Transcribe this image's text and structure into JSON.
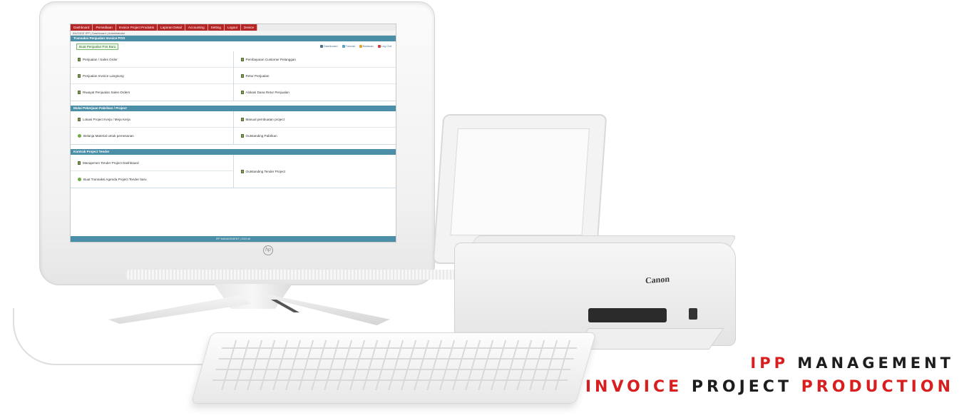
{
  "screen": {
    "nav_tabs": [
      {
        "label": "Dashboard"
      },
      {
        "label": "Persediaan"
      },
      {
        "label": "Invoice Project Produksi"
      },
      {
        "label": "Laporan Detail"
      },
      {
        "label": "Accounting"
      },
      {
        "label": "Setting"
      },
      {
        "label": "Logout"
      },
      {
        "label": "Device"
      }
    ],
    "breadcrumb": "INVOICE IPP | Dashboard | Administrator",
    "sections": [
      {
        "title": "Transaksi Penjualan Invoice POS",
        "primary_button": "Buat Penjualan Pos Baru",
        "actions": [
          "Dashboard",
          "Tutorial",
          "Bantuan",
          "Log Out"
        ],
        "left_items": [
          "Penjualan / Sales Order",
          "Penjualan Invoice Langsung",
          "Riwayat Penjualan Sales Orders"
        ],
        "right_items": [
          "Pembayaran Customer Pelanggan",
          "Retur Penjualan",
          "Alokasi Dana Retur Penjualan"
        ]
      },
      {
        "title": "Mulai Pekerjaan Pabrikan / Project",
        "left_items": [
          "Lokasi Project Kerja / Meja Kerja",
          "Belanja Material untuk pemesanan"
        ],
        "right_items": [
          "Manual pembuatan project",
          "Outstanding Pabrikan"
        ]
      },
      {
        "title": "Kontrak Project Tender",
        "left_items": [
          "Manajemen Tender Project Dashboard",
          "Buat Transaksi Agenda Project Tender baru"
        ],
        "right_items": [
          "Outstanding Tender Project"
        ]
      }
    ],
    "footer": "IPP MANAGEMENT | 2023 all"
  },
  "brand": {
    "line1_accent": "IPP",
    "line1_rest": "MANAGEMENT",
    "line2_word1": "INVOICE",
    "line2_word2": "PROJECT",
    "line2_word3": "PRODUCTION"
  },
  "printer": {
    "brand": "Canon"
  },
  "monitor": {
    "logo": "hp"
  },
  "colors": {
    "nav_red": "#b52525",
    "section_teal": "#4b8ea8",
    "brand_red": "#d81e1e",
    "brand_black": "#1d1d1d"
  },
  "icons": [
    "document-icon",
    "add-icon",
    "dashboard-icon",
    "tutorial-icon",
    "help-icon",
    "logout-icon",
    "webcam-icon",
    "hp-logo-icon"
  ]
}
